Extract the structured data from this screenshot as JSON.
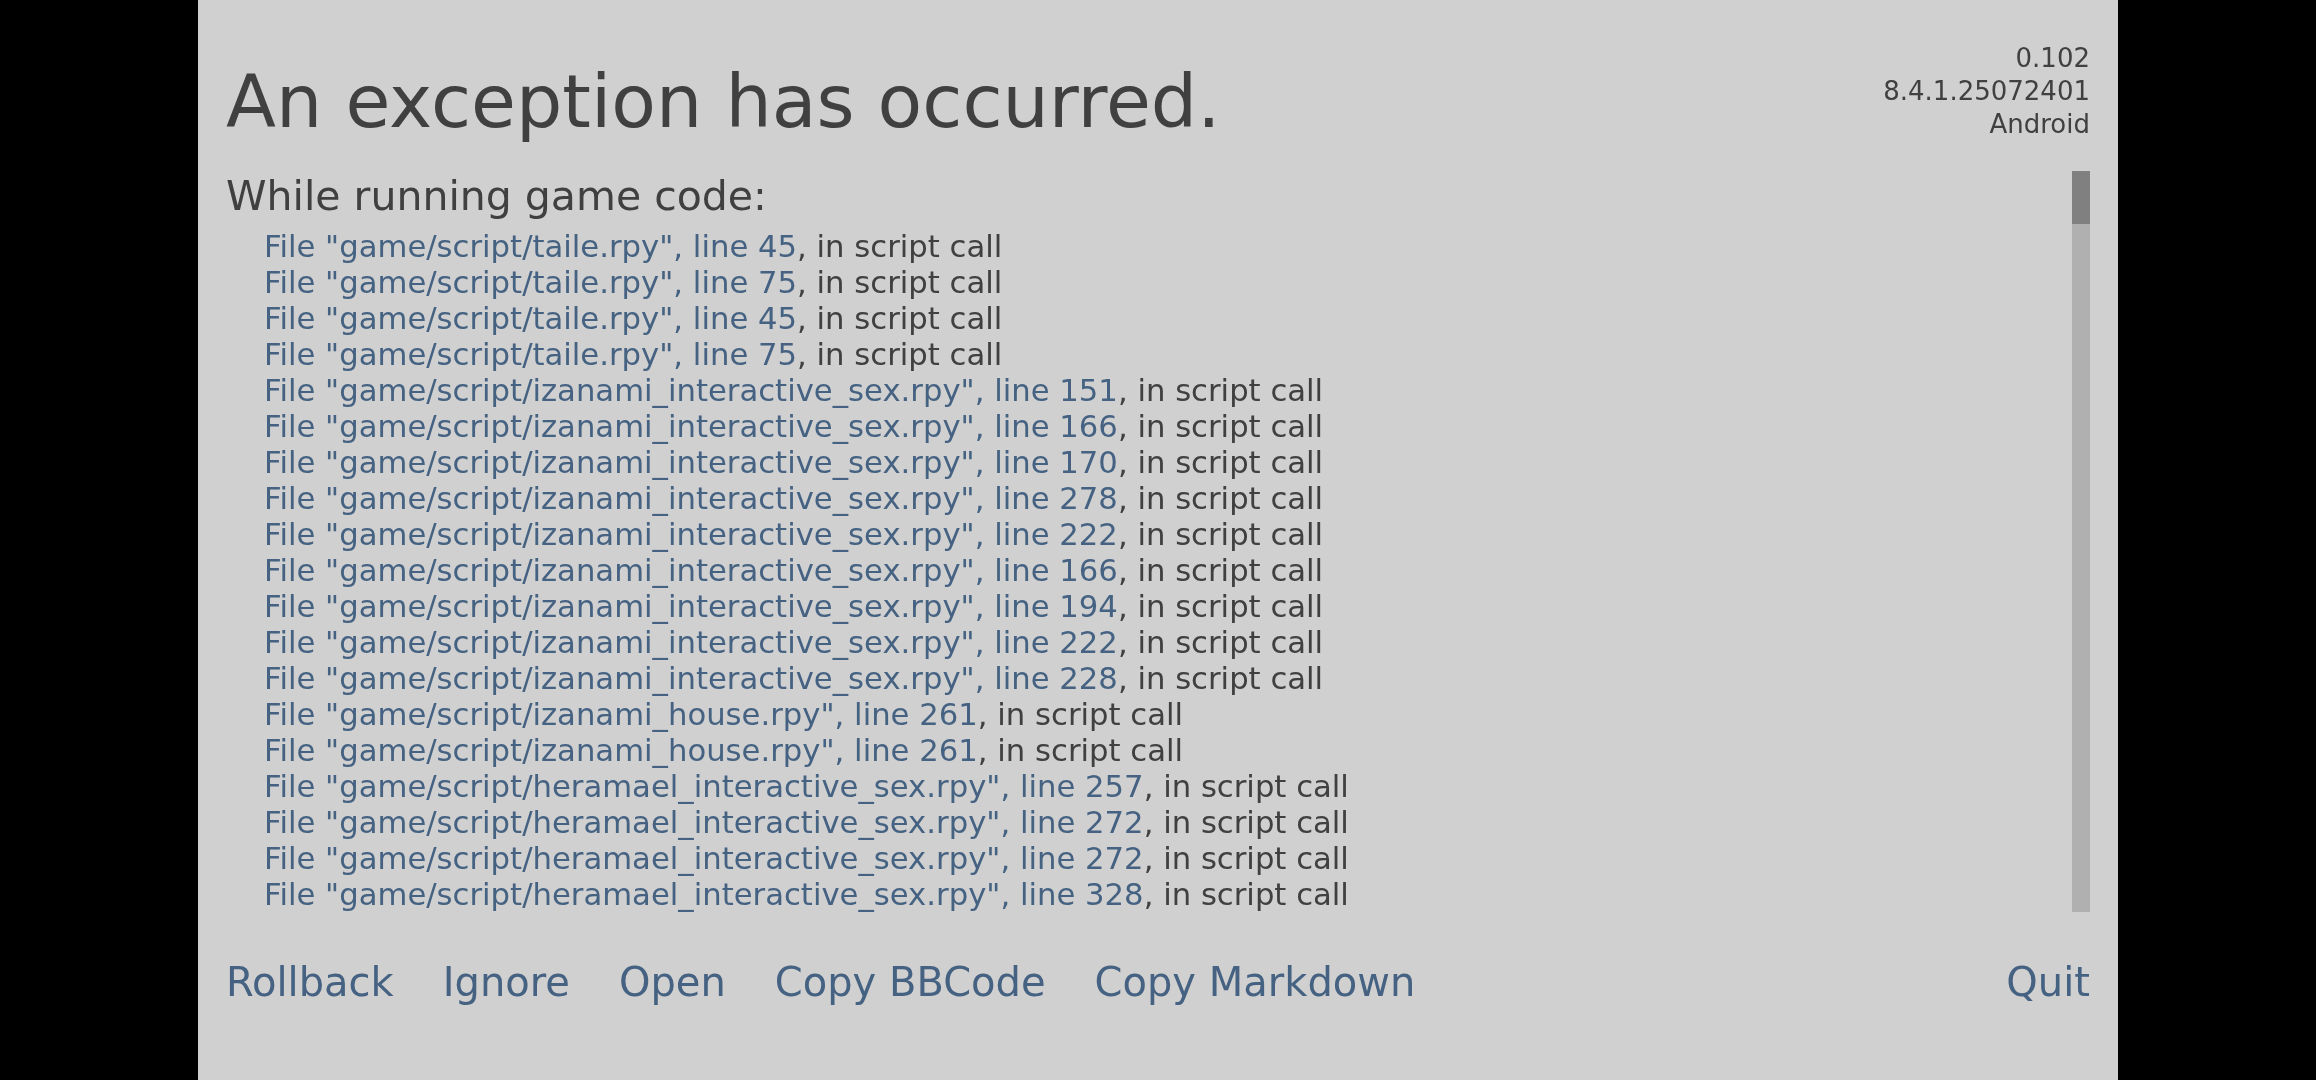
{
  "title": "An exception has occurred.",
  "version_lines": [
    "0.102",
    "8.4.1.25072401",
    "Android"
  ],
  "traceback": {
    "heading": "While running game code:",
    "lines": [
      {
        "link": "File \"game/script/taile.rpy\", line 45",
        "text": ", in script call"
      },
      {
        "link": "File \"game/script/taile.rpy\", line 75",
        "text": ", in script call"
      },
      {
        "link": "File \"game/script/taile.rpy\", line 45",
        "text": ", in script call"
      },
      {
        "link": "File \"game/script/taile.rpy\", line 75",
        "text": ", in script call"
      },
      {
        "link": "File \"game/script/izanami_interactive_sex.rpy\", line 151",
        "text": ", in script call"
      },
      {
        "link": "File \"game/script/izanami_interactive_sex.rpy\", line 166",
        "text": ", in script call"
      },
      {
        "link": "File \"game/script/izanami_interactive_sex.rpy\", line 170",
        "text": ", in script call"
      },
      {
        "link": "File \"game/script/izanami_interactive_sex.rpy\", line 278",
        "text": ", in script call"
      },
      {
        "link": "File \"game/script/izanami_interactive_sex.rpy\", line 222",
        "text": ", in script call"
      },
      {
        "link": "File \"game/script/izanami_interactive_sex.rpy\", line 166",
        "text": ", in script call"
      },
      {
        "link": "File \"game/script/izanami_interactive_sex.rpy\", line 194",
        "text": ", in script call"
      },
      {
        "link": "File \"game/script/izanami_interactive_sex.rpy\", line 222",
        "text": ", in script call"
      },
      {
        "link": "File \"game/script/izanami_interactive_sex.rpy\", line 228",
        "text": ", in script call"
      },
      {
        "link": "File \"game/script/izanami_house.rpy\", line 261",
        "text": ", in script call"
      },
      {
        "link": "File \"game/script/izanami_house.rpy\", line 261",
        "text": ", in script call"
      },
      {
        "link": "File \"game/script/heramael_interactive_sex.rpy\", line 257",
        "text": ", in script call"
      },
      {
        "link": "File \"game/script/heramael_interactive_sex.rpy\", line 272",
        "text": ", in script call"
      },
      {
        "link": "File \"game/script/heramael_interactive_sex.rpy\", line 272",
        "text": ", in script call"
      },
      {
        "link": "File \"game/script/heramael_interactive_sex.rpy\", line 328",
        "text": ", in script call"
      }
    ]
  },
  "actions": [
    "Rollback",
    "Ignore",
    "Open",
    "Copy BBCode",
    "Copy Markdown"
  ],
  "quit_button": {
    "label": "Quit"
  }
}
